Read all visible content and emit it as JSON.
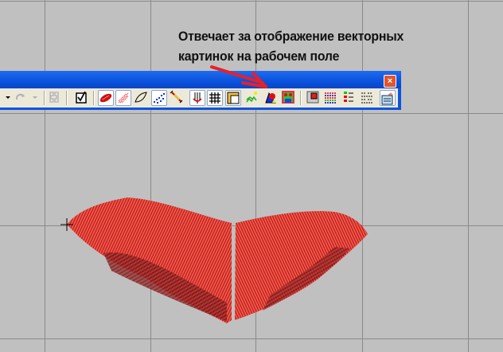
{
  "annotation": {
    "line1": "Отвечает за отображение векторных",
    "line2": "картинок на рабочем поле"
  },
  "toolbar": {
    "close_label": "×",
    "items": [
      "redo",
      "show-stitches",
      "show-fill",
      "show-outline",
      "show-points",
      "show-needle-path",
      "show-center",
      "show-grid",
      "show-rulers",
      "show-background",
      "show-vector-images",
      "show-bitmap-images",
      "show-3d",
      "color-palette",
      "thread-list",
      "stitch-list",
      "properties"
    ]
  },
  "colors": {
    "accent": "#0a55e0",
    "stitch": "#e8322e",
    "arrow": "#e8202a"
  }
}
